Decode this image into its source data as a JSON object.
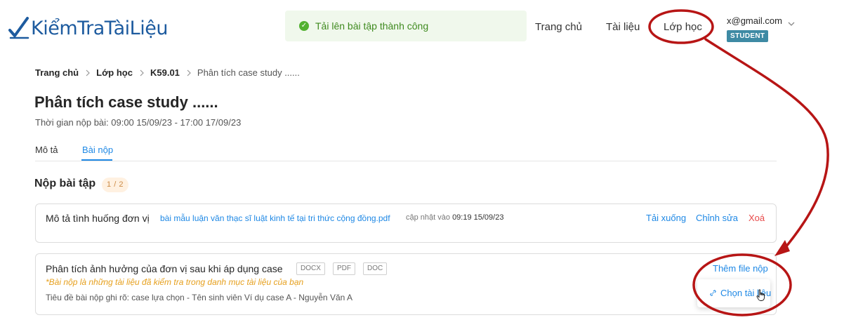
{
  "brand": {
    "logo_text": "KiểmTraTàiLiệu"
  },
  "toast": {
    "message": "Tải lên bài tập thành công",
    "icon": "check-circle-icon",
    "color": "#52b130"
  },
  "nav": {
    "home": "Trang chủ",
    "documents": "Tài liệu",
    "classes": "Lớp học"
  },
  "user": {
    "email": "x@gmail.com",
    "role": "STUDENT"
  },
  "breadcrumb": [
    "Trang chủ",
    "Lớp học",
    "K59.01",
    "Phân tích case study ......"
  ],
  "assignment": {
    "title": "Phân tích case study ......",
    "submit_time": "Thời gian nộp bài: 09:00 15/09/23 - 17:00 17/09/23"
  },
  "tabs": [
    {
      "label": "Mô tả",
      "active": false
    },
    {
      "label": "Bài nộp",
      "active": true
    }
  ],
  "submission": {
    "section_title": "Nộp bài tập",
    "count": "1 / 2"
  },
  "items": [
    {
      "title": "Mô tả tình huống đơn vị",
      "file_name": "bài mẫu luận văn thạc sĩ luật kinh tế tại tri thức cộng đồng.pdf",
      "updated_label": "cập nhật vào",
      "updated_at": "09:19 15/09/23",
      "actions": {
        "download": "Tải xuống",
        "edit": "Chỉnh sửa",
        "delete": "Xoá"
      }
    },
    {
      "title": "Phân tích ảnh hưởng của đơn vị sau khi áp dụng case",
      "formats": [
        "DOCX",
        "PDF",
        "DOC"
      ],
      "note": "*Bài nộp là những tài liệu đã kiểm tra trong danh mục tài liệu của bạn",
      "hint": "Tiêu đề bài nộp ghi rõ: case lựa chọn - Tên sinh viên Ví dụ case A - Nguyễn Văn A",
      "add_label": "Thêm file nộp",
      "dropdown_option": "Chọn tài liệu"
    }
  ],
  "colors": {
    "accent": "#1e88e5",
    "brand": "#1d5b9f",
    "danger": "#e84a4a",
    "annotation": "#b71515",
    "badge": "#3e8aa4"
  }
}
